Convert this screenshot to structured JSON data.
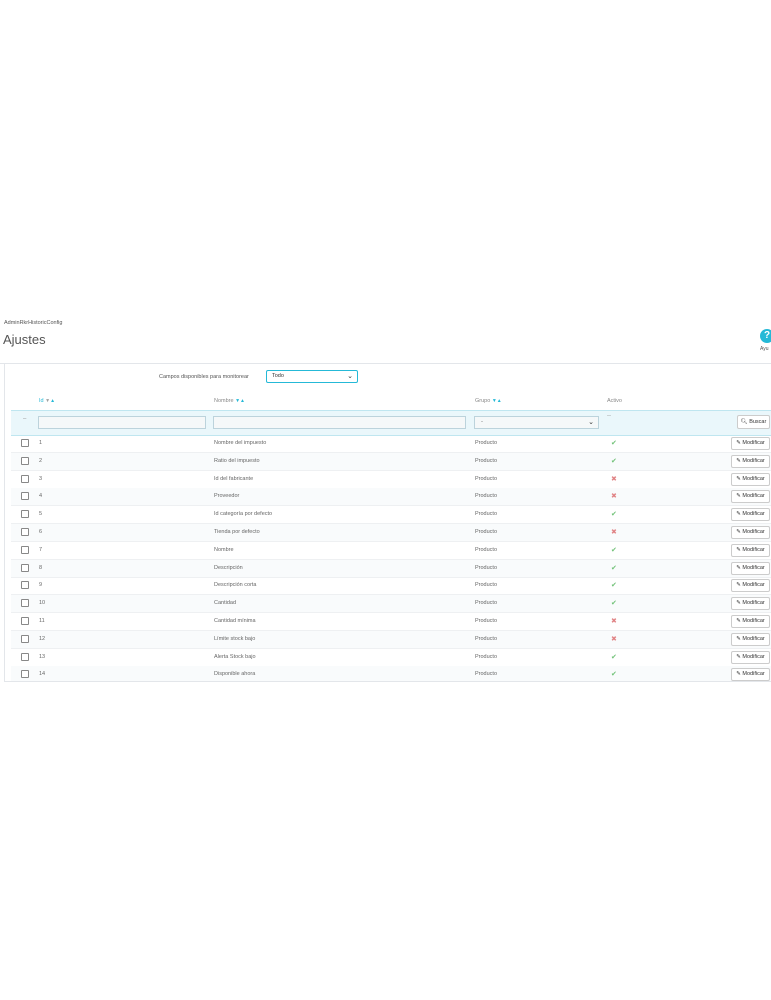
{
  "header": {
    "breadcrumb": "AdminRkrHistoricConfig",
    "title": "Ajustes",
    "help_icon": "?",
    "help_label": "Ayu"
  },
  "monitor": {
    "label": "Campos disponibles para monitorear",
    "value": "Todo"
  },
  "table": {
    "columns": {
      "id": "Id",
      "name": "Nombre",
      "group": "Grupo",
      "active": "Activo"
    },
    "filter": {
      "group_value": "-",
      "active_value": "--",
      "search_label": "Buscar"
    },
    "edit_label": "Modificar",
    "rows": [
      {
        "id": "1",
        "name": "Nombre del impuesto",
        "group": "Producto",
        "active": "✔"
      },
      {
        "id": "2",
        "name": "Ratio del impuesto",
        "group": "Producto",
        "active": "✔"
      },
      {
        "id": "3",
        "name": "Id del fabricante",
        "group": "Producto",
        "active": "✖"
      },
      {
        "id": "4",
        "name": "Proveedor",
        "group": "Producto",
        "active": "✖"
      },
      {
        "id": "5",
        "name": "Id categoría por defecto",
        "group": "Producto",
        "active": "✔"
      },
      {
        "id": "6",
        "name": "Tienda por defecto",
        "group": "Producto",
        "active": "✖"
      },
      {
        "id": "7",
        "name": "Nombre",
        "group": "Producto",
        "active": "✔"
      },
      {
        "id": "8",
        "name": "Descripción",
        "group": "Producto",
        "active": "✔"
      },
      {
        "id": "9",
        "name": "Descripción corta",
        "group": "Producto",
        "active": "✔"
      },
      {
        "id": "10",
        "name": "Cantidad",
        "group": "Producto",
        "active": "✔"
      },
      {
        "id": "11",
        "name": "Cantidad mínima",
        "group": "Producto",
        "active": "✖"
      },
      {
        "id": "12",
        "name": "Límite stock bajo",
        "group": "Producto",
        "active": "✖"
      },
      {
        "id": "13",
        "name": "Alerta Stock bajo",
        "group": "Producto",
        "active": "✔"
      },
      {
        "id": "14",
        "name": "Disponible ahora",
        "group": "Producto",
        "active": "✔"
      }
    ]
  },
  "colors": {
    "accent": "#25b9d7",
    "enabled": "#72c279",
    "disabled": "#e08284"
  }
}
